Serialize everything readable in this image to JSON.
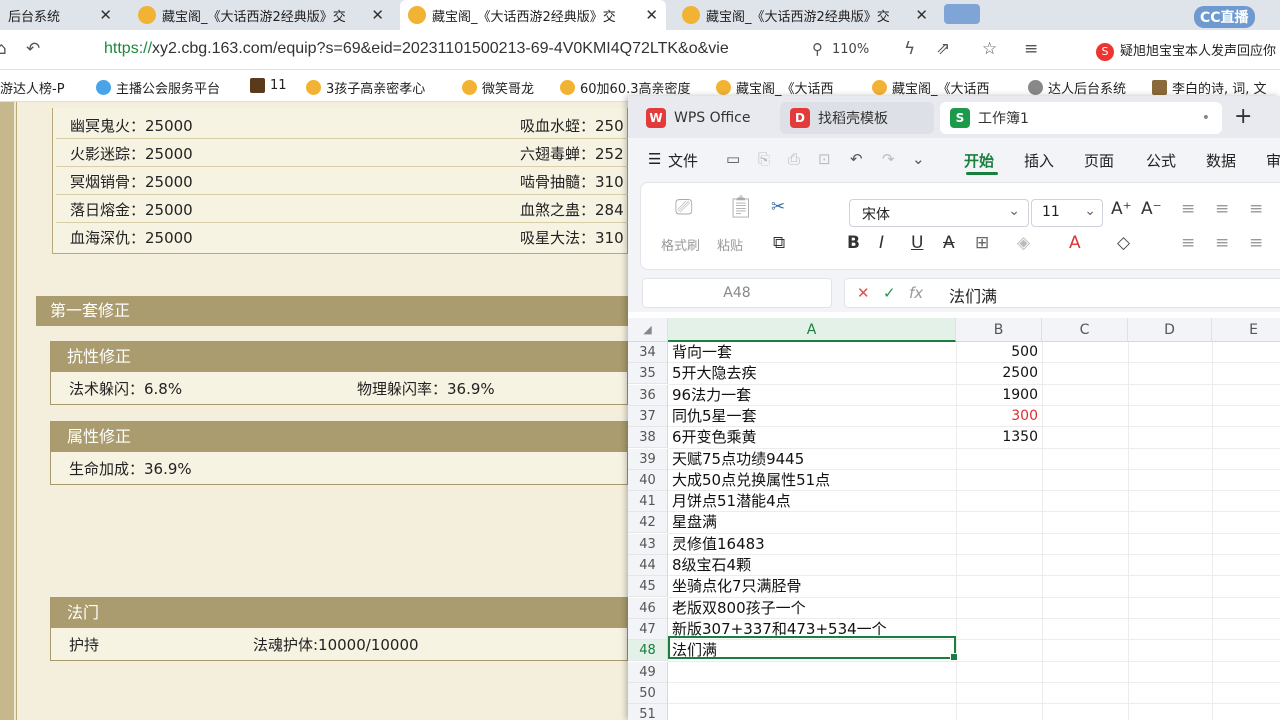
{
  "browser": {
    "tabs": [
      {
        "label": "后台系统",
        "closable": true
      },
      {
        "label": "藏宝阁_《大话西游2经典版》交",
        "closable": true
      },
      {
        "label": "藏宝阁_《大话西游2经典版》交",
        "closable": true,
        "active": true
      },
      {
        "label": "藏宝阁_《大话西游2经典版》交",
        "closable": true
      }
    ],
    "close_glyph": "✕",
    "cc_logo": "CC直播",
    "url_scheme": "https://",
    "url_rest": "xy2.cbg.163.com/equip?s=69&eid=20231101500213-69-4V0KMI4Q72LTK&o&vie",
    "zoom": "110%",
    "notice_badge": "S",
    "notice": "疑旭旭宝宝本人发声回应你",
    "bookmarks": [
      "游达人榜-P",
      "主播公会服务平台",
      "11",
      "3孩子高亲密孝心",
      "微笑哥龙",
      "60加60.3高亲密度",
      "藏宝阁_《大话西",
      "藏宝阁_《大话西",
      "达人后台系统",
      "李白的诗, 词, 文"
    ]
  },
  "game": {
    "skills_left": [
      "幽冥鬼火：25000",
      "火影迷踪：25000",
      "冥烟销骨：25000",
      "落日熔金：25000",
      "血海深仇：25000"
    ],
    "skills_right": [
      "吸血水蛭：250",
      "六翅毒蝉：252",
      "啮骨抽髓：310",
      "血煞之蛊：284",
      "吸星大法：310"
    ],
    "section1_title": "第一套修正",
    "resist": {
      "title": "抗性修正",
      "items": [
        "法术躲闪：6.8%",
        "物理躲闪率：36.9%"
      ]
    },
    "attr": {
      "title": "属性修正",
      "items": [
        "生命加成：36.9%"
      ]
    },
    "famen": {
      "title": "法门",
      "items": [
        "护持",
        "法魂护体:10000/10000"
      ]
    }
  },
  "wps": {
    "tabs": [
      {
        "label": "WPS Office",
        "icon_text": "W",
        "icon_color": "#e33a3a"
      },
      {
        "label": "找稻壳模板",
        "icon_text": "D",
        "icon_color": "#e33a3a"
      },
      {
        "label": "工作簿1",
        "icon_text": "S",
        "icon_color": "#1a9a4a",
        "active": true
      }
    ],
    "tab_dot": "•",
    "new_tab": "+",
    "menu": {
      "file": "文件",
      "items": [
        "开始",
        "插入",
        "页面",
        "公式",
        "数据",
        "审"
      ]
    },
    "ribbon": {
      "format_painter": "格式刷",
      "paste": "粘贴",
      "font_name": "宋体",
      "font_size": "11",
      "bold": "B",
      "italic": "I",
      "underline": "U",
      "strike": "A"
    },
    "namebox": "A48",
    "cancel": "✕",
    "confirm": "✓",
    "fx": "fx",
    "formula": "法们满",
    "corner": "◢",
    "columns": [
      "A",
      "B",
      "C",
      "D",
      "E"
    ],
    "rows": [
      {
        "n": "34",
        "a": "背向一套",
        "b": "500"
      },
      {
        "n": "35",
        "a": "5开大隐去疾",
        "b": "2500"
      },
      {
        "n": "36",
        "a": "96法力一套",
        "b": "1900"
      },
      {
        "n": "37",
        "a": "同仇5星一套",
        "b": "300",
        "red": true
      },
      {
        "n": "38",
        "a": "6开变色乘黄",
        "b": "1350"
      },
      {
        "n": "39",
        "a": "天赋75点功绩9445",
        "b": ""
      },
      {
        "n": "40",
        "a": "大成50点兑换属性51点",
        "b": ""
      },
      {
        "n": "41",
        "a": "月饼点51潜能4点",
        "b": ""
      },
      {
        "n": "42",
        "a": "星盘满",
        "b": ""
      },
      {
        "n": "43",
        "a": "灵修值16483",
        "b": ""
      },
      {
        "n": "44",
        "a": "8级宝石4颗",
        "b": ""
      },
      {
        "n": "45",
        "a": "坐骑点化7只满胫骨",
        "b": ""
      },
      {
        "n": "46",
        "a": "老版双800孩子一个",
        "b": ""
      },
      {
        "n": "47",
        "a": "新版307+337和473+534一个",
        "b": ""
      },
      {
        "n": "48",
        "a": "法们满",
        "b": ""
      },
      {
        "n": "49",
        "a": "",
        "b": ""
      },
      {
        "n": "50",
        "a": "",
        "b": ""
      },
      {
        "n": "51",
        "a": "",
        "b": ""
      }
    ]
  }
}
